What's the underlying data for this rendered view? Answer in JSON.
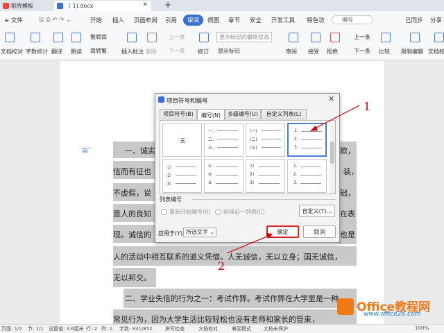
{
  "titlebar": {
    "tabs": [
      {
        "label": "稻壳模板",
        "color": "#e84b3a"
      },
      {
        "label": "（          1).docx",
        "color": "#3b6fd1",
        "close": "✕"
      }
    ],
    "add": "+"
  },
  "menubar": {
    "file": "≡ 文件",
    "items": [
      "开始",
      "插入",
      "页面布局",
      "引用",
      "审阅",
      "视图",
      "章节",
      "安全",
      "开发工具",
      "特色功"
    ],
    "active_index": 4,
    "search_placeholder": "编号",
    "sync": "已同步",
    "share": "分享"
  },
  "ribbon": {
    "items": [
      {
        "label": "文档校对"
      },
      {
        "label": "字数统计"
      },
      {
        "label": "翻译"
      },
      {
        "label": "朗读"
      },
      {
        "label": "繁转简"
      },
      {
        "label": "简转繁"
      },
      {
        "label": "插入批注"
      },
      {
        "label": "删除"
      },
      {
        "label": "上一条"
      },
      {
        "label": "下一条"
      },
      {
        "label": "修订"
      },
      {
        "label": "显示标记的最终状态"
      },
      {
        "label": "显示标记"
      },
      {
        "label": "审阅"
      },
      {
        "label": "接受"
      },
      {
        "label": "拒绝"
      },
      {
        "label": "上一条"
      },
      {
        "label": "下一条"
      },
      {
        "label": "比较"
      },
      {
        "label": "限制编辑"
      },
      {
        "label": "文档权"
      }
    ]
  },
  "document": {
    "lines": [
      "一、诚实",
      "信而有征也",
      "不虚假，说",
      "是人的良知",
      "现。诚信的",
      "人的活动中相互联系的道义凭借。人无诚信，无以立身；国无诚信，",
      "无以邦交。",
      "二、学业失信的行为之一：考试作弊。考试作弊在大学里是一种",
      "常见行为，因为大学生活比较轻松也没有老师和家长的管束，"
    ],
    "right_fragments": [
      "欺，",
      "，装，",
      "础，",
      "在表",
      "也是"
    ]
  },
  "dialog": {
    "title": "项目符号和编号",
    "close": "✕",
    "tabs": [
      "项目符号(B)",
      "编号(N)",
      "多级编号(U)",
      "自定义列表(L)"
    ],
    "active_tab": 1,
    "none_label": "无",
    "cells": [
      {
        "items": [
          "一、",
          "二、",
          "三、"
        ]
      },
      {
        "items": [
          "(一)",
          "(二)",
          "(三)"
        ]
      },
      {
        "items": [
          "1.",
          "2.",
          "3."
        ],
        "selected": true
      },
      {
        "items": [
          "⑴",
          "⑵",
          "⑶"
        ]
      },
      {
        "items": [
          "①",
          "②",
          "③"
        ]
      },
      {
        "items": [
          "1)",
          "2)",
          "3)"
        ]
      },
      {
        "items": [
          "1.",
          "2.",
          "3."
        ]
      }
    ],
    "list_numbering_label": "列表编号",
    "restart_label": "重新开始编号(R)",
    "continue_label": "继续前一列表(C)",
    "custom_button": "自定义(T)...",
    "apply_to_label": "应用于(Y):",
    "apply_to_value": "所选文字",
    "ok_button": "确定",
    "cancel_button": "取消"
  },
  "annotations": {
    "one": "1",
    "two": "2",
    "color": "#cc0000"
  },
  "statusbar": {
    "items": [
      "页面: 1/2",
      "节: 1/1",
      "设置值: 3.6厘米",
      "行: 2",
      "列: 1",
      "字数: 831/852",
      "拼写检查",
      "文档校对",
      "兼容模式",
      "文档未保护"
    ],
    "zoom": "100%"
  },
  "watermark": {
    "brand": "Office教程网",
    "url": "www.office26.com"
  }
}
